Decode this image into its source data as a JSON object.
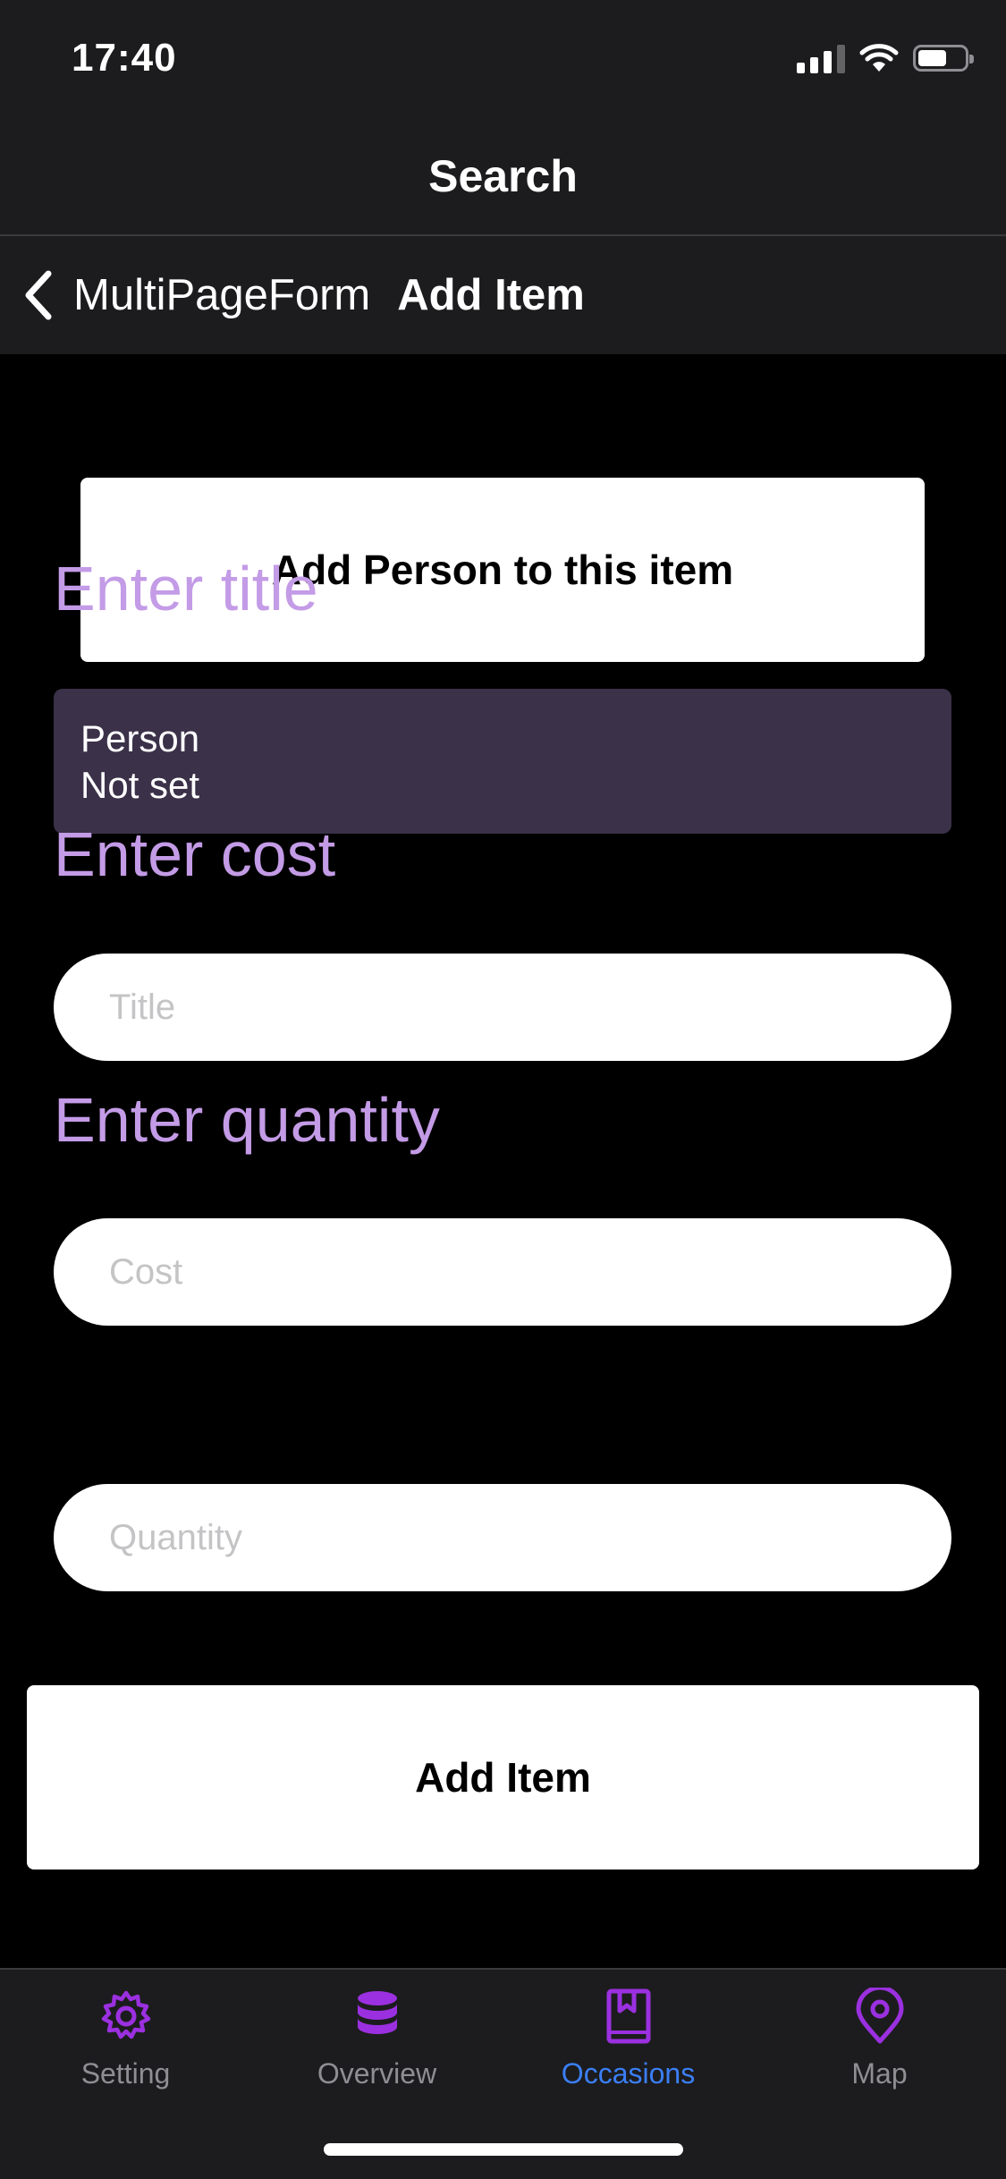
{
  "status_bar": {
    "time": "17:40"
  },
  "title_bar": {
    "title": "Search"
  },
  "nav": {
    "back_label": "MultiPageForm",
    "title": "Add Item"
  },
  "form": {
    "add_person_label": "Add Person to this item",
    "person_card": {
      "title": "Person",
      "value": "Not set"
    },
    "title_field": {
      "label": "Enter title",
      "placeholder": "Title",
      "value": ""
    },
    "cost_field": {
      "label": "Enter cost",
      "placeholder": "Cost",
      "value": ""
    },
    "quantity_field": {
      "label": "Enter quantity",
      "placeholder": "Quantity",
      "value": ""
    },
    "submit_label": "Add Item"
  },
  "tab_bar": {
    "active_index": 2,
    "tabs": [
      {
        "label": "Setting",
        "icon": "gear-icon"
      },
      {
        "label": "Overview",
        "icon": "database-icon"
      },
      {
        "label": "Occasions",
        "icon": "bookmark-book-icon"
      },
      {
        "label": "Map",
        "icon": "map-pin-icon"
      }
    ]
  },
  "colors": {
    "accent_purple": "#9b30e0",
    "label_purple": "#c39be6",
    "active_tab_blue": "#3b7ff5",
    "person_card_bg": "#3b3149",
    "bar_bg": "#1c1c1e"
  }
}
